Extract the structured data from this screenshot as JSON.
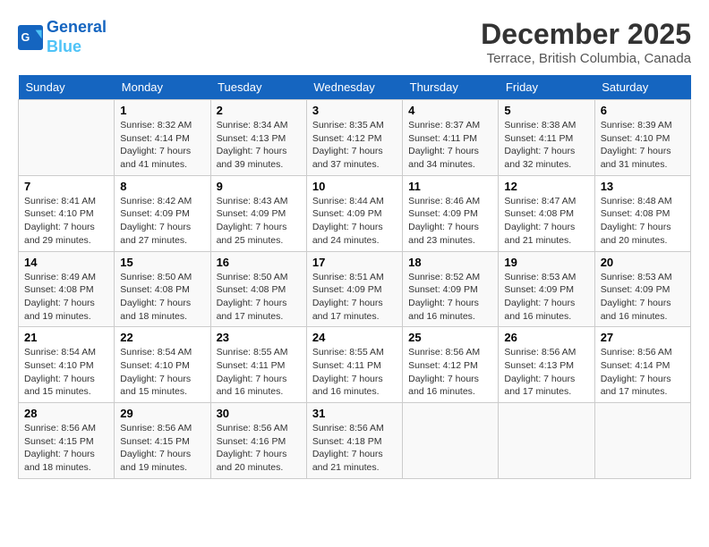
{
  "header": {
    "logo_line1": "General",
    "logo_line2": "Blue",
    "month_title": "December 2025",
    "location": "Terrace, British Columbia, Canada"
  },
  "weekdays": [
    "Sunday",
    "Monday",
    "Tuesday",
    "Wednesday",
    "Thursday",
    "Friday",
    "Saturday"
  ],
  "weeks": [
    [
      {
        "day": "",
        "sunrise": "",
        "sunset": "",
        "daylight": ""
      },
      {
        "day": "1",
        "sunrise": "8:32 AM",
        "sunset": "4:14 PM",
        "daylight": "7 hours and 41 minutes."
      },
      {
        "day": "2",
        "sunrise": "8:34 AM",
        "sunset": "4:13 PM",
        "daylight": "7 hours and 39 minutes."
      },
      {
        "day": "3",
        "sunrise": "8:35 AM",
        "sunset": "4:12 PM",
        "daylight": "7 hours and 37 minutes."
      },
      {
        "day": "4",
        "sunrise": "8:37 AM",
        "sunset": "4:11 PM",
        "daylight": "7 hours and 34 minutes."
      },
      {
        "day": "5",
        "sunrise": "8:38 AM",
        "sunset": "4:11 PM",
        "daylight": "7 hours and 32 minutes."
      },
      {
        "day": "6",
        "sunrise": "8:39 AM",
        "sunset": "4:10 PM",
        "daylight": "7 hours and 31 minutes."
      }
    ],
    [
      {
        "day": "7",
        "sunrise": "8:41 AM",
        "sunset": "4:10 PM",
        "daylight": "7 hours and 29 minutes."
      },
      {
        "day": "8",
        "sunrise": "8:42 AM",
        "sunset": "4:09 PM",
        "daylight": "7 hours and 27 minutes."
      },
      {
        "day": "9",
        "sunrise": "8:43 AM",
        "sunset": "4:09 PM",
        "daylight": "7 hours and 25 minutes."
      },
      {
        "day": "10",
        "sunrise": "8:44 AM",
        "sunset": "4:09 PM",
        "daylight": "7 hours and 24 minutes."
      },
      {
        "day": "11",
        "sunrise": "8:46 AM",
        "sunset": "4:09 PM",
        "daylight": "7 hours and 23 minutes."
      },
      {
        "day": "12",
        "sunrise": "8:47 AM",
        "sunset": "4:08 PM",
        "daylight": "7 hours and 21 minutes."
      },
      {
        "day": "13",
        "sunrise": "8:48 AM",
        "sunset": "4:08 PM",
        "daylight": "7 hours and 20 minutes."
      }
    ],
    [
      {
        "day": "14",
        "sunrise": "8:49 AM",
        "sunset": "4:08 PM",
        "daylight": "7 hours and 19 minutes."
      },
      {
        "day": "15",
        "sunrise": "8:50 AM",
        "sunset": "4:08 PM",
        "daylight": "7 hours and 18 minutes."
      },
      {
        "day": "16",
        "sunrise": "8:50 AM",
        "sunset": "4:08 PM",
        "daylight": "7 hours and 17 minutes."
      },
      {
        "day": "17",
        "sunrise": "8:51 AM",
        "sunset": "4:09 PM",
        "daylight": "7 hours and 17 minutes."
      },
      {
        "day": "18",
        "sunrise": "8:52 AM",
        "sunset": "4:09 PM",
        "daylight": "7 hours and 16 minutes."
      },
      {
        "day": "19",
        "sunrise": "8:53 AM",
        "sunset": "4:09 PM",
        "daylight": "7 hours and 16 minutes."
      },
      {
        "day": "20",
        "sunrise": "8:53 AM",
        "sunset": "4:09 PM",
        "daylight": "7 hours and 16 minutes."
      }
    ],
    [
      {
        "day": "21",
        "sunrise": "8:54 AM",
        "sunset": "4:10 PM",
        "daylight": "7 hours and 15 minutes."
      },
      {
        "day": "22",
        "sunrise": "8:54 AM",
        "sunset": "4:10 PM",
        "daylight": "7 hours and 15 minutes."
      },
      {
        "day": "23",
        "sunrise": "8:55 AM",
        "sunset": "4:11 PM",
        "daylight": "7 hours and 16 minutes."
      },
      {
        "day": "24",
        "sunrise": "8:55 AM",
        "sunset": "4:11 PM",
        "daylight": "7 hours and 16 minutes."
      },
      {
        "day": "25",
        "sunrise": "8:56 AM",
        "sunset": "4:12 PM",
        "daylight": "7 hours and 16 minutes."
      },
      {
        "day": "26",
        "sunrise": "8:56 AM",
        "sunset": "4:13 PM",
        "daylight": "7 hours and 17 minutes."
      },
      {
        "day": "27",
        "sunrise": "8:56 AM",
        "sunset": "4:14 PM",
        "daylight": "7 hours and 17 minutes."
      }
    ],
    [
      {
        "day": "28",
        "sunrise": "8:56 AM",
        "sunset": "4:15 PM",
        "daylight": "7 hours and 18 minutes."
      },
      {
        "day": "29",
        "sunrise": "8:56 AM",
        "sunset": "4:15 PM",
        "daylight": "7 hours and 19 minutes."
      },
      {
        "day": "30",
        "sunrise": "8:56 AM",
        "sunset": "4:16 PM",
        "daylight": "7 hours and 20 minutes."
      },
      {
        "day": "31",
        "sunrise": "8:56 AM",
        "sunset": "4:18 PM",
        "daylight": "7 hours and 21 minutes."
      },
      {
        "day": "",
        "sunrise": "",
        "sunset": "",
        "daylight": ""
      },
      {
        "day": "",
        "sunrise": "",
        "sunset": "",
        "daylight": ""
      },
      {
        "day": "",
        "sunrise": "",
        "sunset": "",
        "daylight": ""
      }
    ]
  ]
}
